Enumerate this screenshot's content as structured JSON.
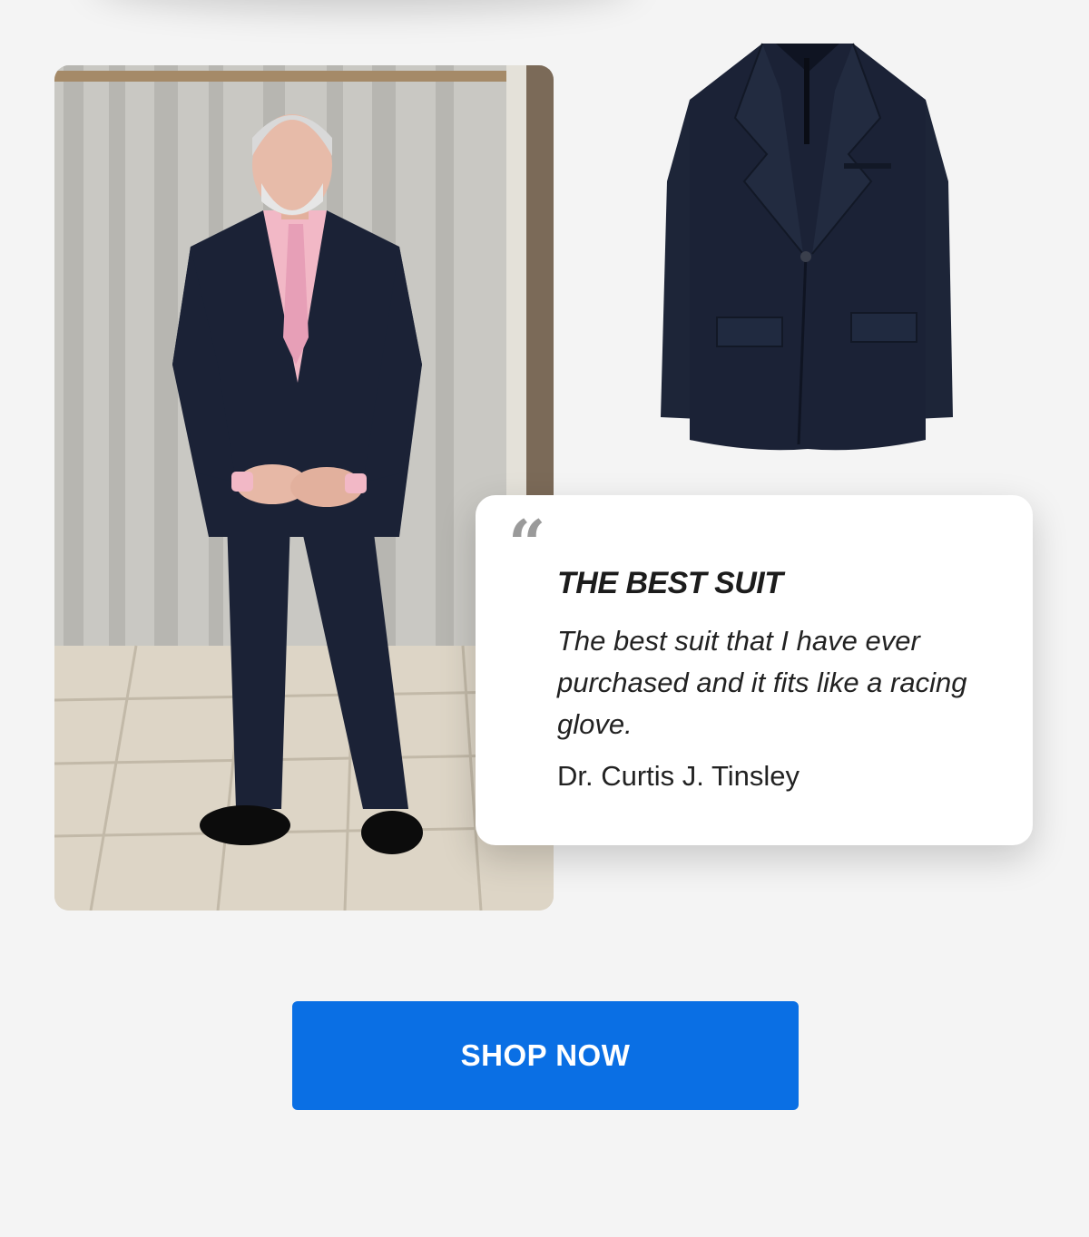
{
  "review": {
    "title": "THE BEST SUIT",
    "body": "The best suit that I have ever purchased and it fits like a racing glove.",
    "author": "Dr. Curtis J. Tinsley",
    "quote_icon": "quote-mark-icon"
  },
  "cta": {
    "label": "SHOP NOW"
  },
  "colors": {
    "background": "#f4f4f4",
    "button": "#0a6fe4",
    "suit_navy": "#1b2236",
    "shirt_pink": "#f2b8c6"
  }
}
